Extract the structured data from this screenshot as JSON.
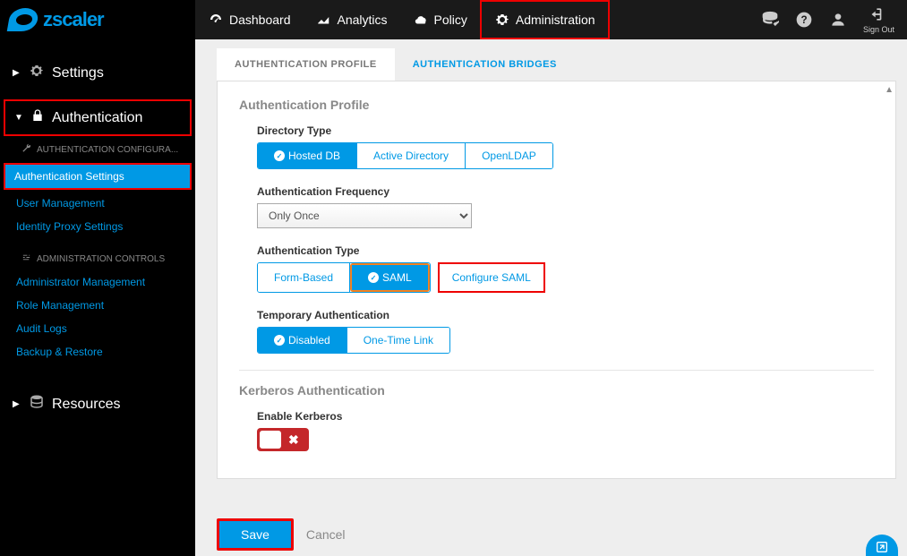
{
  "brand": "zscaler",
  "header": {
    "tabs": {
      "dashboard": "Dashboard",
      "analytics": "Analytics",
      "policy": "Policy",
      "administration": "Administration"
    },
    "signout": "Sign Out"
  },
  "sidebar": {
    "settings": "Settings",
    "authentication": "Authentication",
    "auth_config_head": "AUTHENTICATION CONFIGURA...",
    "items": {
      "auth_settings": "Authentication Settings",
      "user_mgmt": "User Management",
      "identity_proxy": "Identity Proxy Settings"
    },
    "admin_controls_head": "ADMINISTRATION CONTROLS",
    "admin_items": {
      "admin_mgmt": "Administrator Management",
      "role_mgmt": "Role Management",
      "audit_logs": "Audit Logs",
      "backup_restore": "Backup & Restore"
    },
    "resources": "Resources"
  },
  "tabs": {
    "profile": "AUTHENTICATION PROFILE",
    "bridges": "AUTHENTICATION BRIDGES"
  },
  "profile": {
    "heading": "Authentication Profile",
    "directory_type": {
      "label": "Directory Type",
      "options": {
        "hosted": "Hosted DB",
        "ad": "Active Directory",
        "openldap": "OpenLDAP"
      }
    },
    "auth_freq": {
      "label": "Authentication Frequency",
      "value": "Only Once"
    },
    "auth_type": {
      "label": "Authentication Type",
      "options": {
        "form": "Form-Based",
        "saml": "SAML"
      },
      "config_link": "Configure SAML"
    },
    "temp_auth": {
      "label": "Temporary Authentication",
      "options": {
        "disabled": "Disabled",
        "otl": "One-Time Link"
      }
    },
    "kerberos": {
      "heading": "Kerberos Authentication",
      "label": "Enable Kerberos"
    }
  },
  "footer": {
    "save": "Save",
    "cancel": "Cancel"
  }
}
